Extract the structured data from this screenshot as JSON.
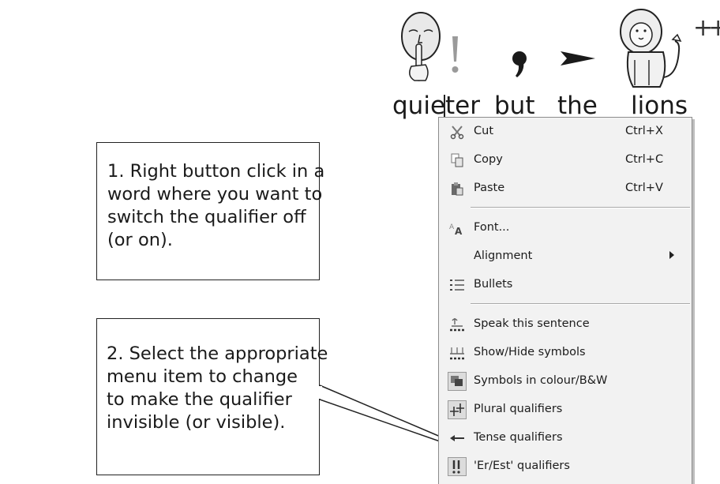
{
  "symbol_words": [
    "quieter",
    "but",
    "the",
    "lions"
  ],
  "plural_mark": "++",
  "menu": {
    "items": [
      {
        "label": "Cut",
        "shortcut": "Ctrl+X",
        "icon": "scissors-icon"
      },
      {
        "label": "Copy",
        "shortcut": "Ctrl+C",
        "icon": "copy-icon"
      },
      {
        "label": "Paste",
        "shortcut": "Ctrl+V",
        "icon": "paste-icon"
      },
      {
        "label": "Font...",
        "icon": "font-icon"
      },
      {
        "label": "Alignment",
        "icon": "",
        "submenu": true
      },
      {
        "label": "Bullets",
        "icon": "bullets-icon"
      },
      {
        "label": "Speak this sentence",
        "icon": "speaker-icon"
      },
      {
        "label": "Show/Hide symbols",
        "icon": "symbols-toggle-icon"
      },
      {
        "label": "Symbols in colour/B&W",
        "icon": "colour-icon",
        "checked": true
      },
      {
        "label": "Plural qualifiers",
        "icon": "plural-qualifier-icon",
        "checked": true
      },
      {
        "label": "Tense qualifiers",
        "icon": "tense-qualifier-icon"
      },
      {
        "label": "'Er/Est' qualifiers",
        "icon": "er-est-qualifier-icon",
        "checked": true
      }
    ]
  },
  "callout1": {
    "lines": [
      "1. Right button click in a",
      "word where you want to",
      "switch the qualifier off",
      "(or on)."
    ]
  },
  "callout2": {
    "lines": [
      "2. Select the appropriate",
      "menu item to change",
      "to make the qualifier",
      "invisible (or visible)."
    ]
  }
}
